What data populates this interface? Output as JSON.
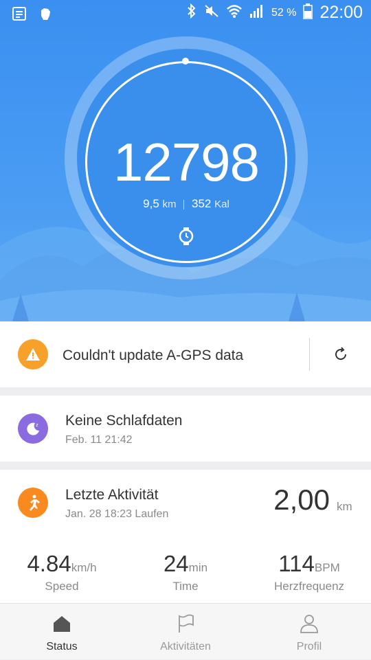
{
  "status_bar": {
    "battery": "52 %",
    "time": "22:00",
    "icons": [
      "notes-icon",
      "fist-icon",
      "bluetooth-icon",
      "mute-icon",
      "wifi-icon",
      "signal-icon",
      "battery-icon"
    ]
  },
  "hero": {
    "steps": "12798",
    "distance_value": "9,5",
    "distance_unit": "km",
    "calories_value": "352",
    "calories_unit": "Kal",
    "device_icon": "watch-icon"
  },
  "agps_card": {
    "message": "Couldn't update A-GPS data",
    "icon": "warning-icon",
    "action_icon": "refresh-icon",
    "color": "#f7a12a"
  },
  "sleep_card": {
    "title": "Keine Schlafdaten",
    "subtitle": "Feb. 11 21:42",
    "icon": "moon-icon",
    "color": "#8a6be0"
  },
  "activity_card": {
    "title": "Letzte Aktivität",
    "subtitle": "Jan. 28 18:23 Laufen",
    "distance": "2,00",
    "distance_unit": "km",
    "icon": "runner-icon",
    "color": "#f98a1f",
    "stats": [
      {
        "value": "4.84",
        "unit": "km/h",
        "label": "Speed"
      },
      {
        "value": "24",
        "unit": "min",
        "label": "Time"
      },
      {
        "value": "114",
        "unit": "BPM",
        "label": "Herzfrequenz"
      }
    ]
  },
  "bottom_nav": [
    {
      "label": "Status",
      "icon": "home-icon",
      "active": true
    },
    {
      "label": "Aktivitäten",
      "icon": "flag-icon",
      "active": false
    },
    {
      "label": "Profil",
      "icon": "person-icon",
      "active": false
    }
  ]
}
